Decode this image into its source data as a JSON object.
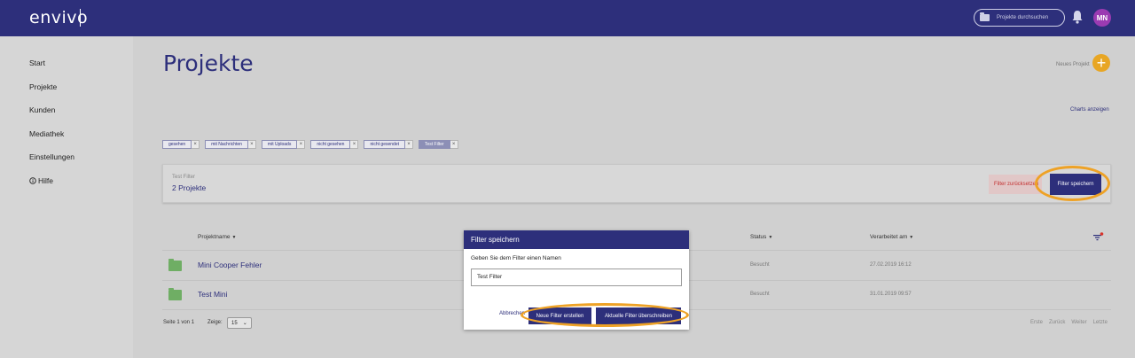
{
  "header": {
    "logo": "envivo",
    "search_placeholder": "Projekte durchsuchen",
    "avatar_initials": "MN",
    "bell_icon": "bell-icon",
    "search_icon": "folder-icon"
  },
  "sidebar": {
    "items": [
      {
        "label": "Start"
      },
      {
        "label": "Projekte"
      },
      {
        "label": "Kunden"
      },
      {
        "label": "Mediathek"
      },
      {
        "label": "Einstellungen"
      },
      {
        "label": "Hilfe",
        "icon": "info-circle-icon"
      }
    ]
  },
  "main": {
    "title": "Projekte",
    "new_project_label": "Neues Projekt",
    "charts_link": "Charts anzeigen",
    "filter_chips": [
      {
        "label": "gesehen"
      },
      {
        "label": "mit Nachrichten"
      },
      {
        "label": "mit Uploads"
      },
      {
        "label": "nicht gesehen"
      },
      {
        "label": "nicht gesendet"
      },
      {
        "label": "Test Filter",
        "active": true
      }
    ],
    "filter_box": {
      "name": "Test Filter",
      "count": "2 Projekte",
      "reset_label": "Filter zurücksetzen",
      "save_label": "Filter speichern"
    },
    "table": {
      "headers": {
        "name": "Projektname",
        "status": "Status",
        "edited": "Verarbeitet am"
      },
      "rows": [
        {
          "name": "Mini Cooper Fehler",
          "status": "Besucht",
          "date": "27.02.2019 16:12"
        },
        {
          "name": "Test Mini",
          "status": "Besucht",
          "date": "31.01.2019 09:57"
        }
      ]
    },
    "pagination": {
      "page_info": "Seite 1 von 1",
      "size_label": "Zeige:",
      "size_value": "15",
      "first": "Erste",
      "prev": "Zurück",
      "next": "Weiter",
      "last": "Letzte"
    }
  },
  "modal": {
    "title": "Filter speichern",
    "prompt": "Geben Sie dem Filter einen Namen",
    "input_value": "Test Filter",
    "cancel_label": "Abbrechen",
    "new_filter_label": "Neue Filter erstellen",
    "overwrite_label": "Aktuelle Filter überschreiben"
  },
  "colors": {
    "primary": "#2d2f7b",
    "accent": "#e8a624",
    "highlight": "#eea226",
    "danger": "#c43030",
    "folder": "#6fae64"
  }
}
